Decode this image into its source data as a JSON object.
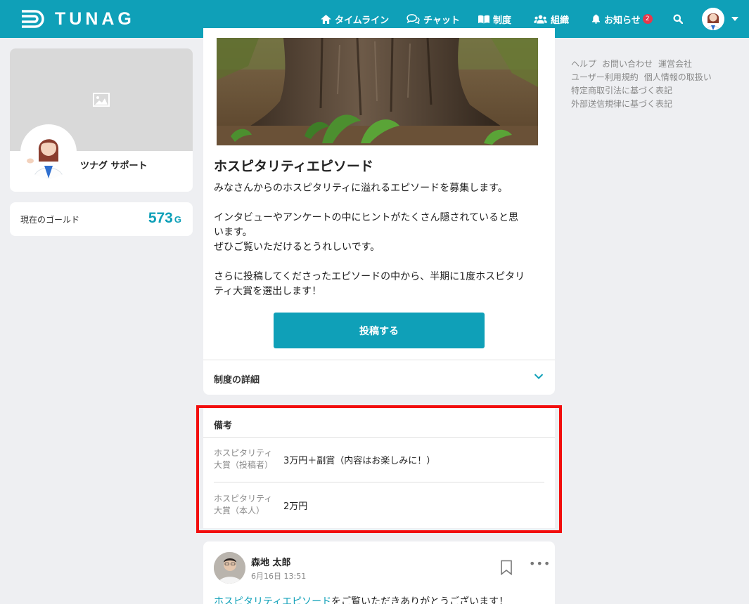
{
  "brand": {
    "name": "TUNAG"
  },
  "nav": {
    "timeline": "タイムライン",
    "chat": "チャット",
    "system": "制度",
    "org": "組織",
    "notifications": "お知らせ",
    "notification_count": "2"
  },
  "sidebar": {
    "profile_name": "ツナグ サポート",
    "gold_label": "現在のゴールド",
    "gold_value": "573",
    "gold_unit": "G"
  },
  "post": {
    "title": "ホスピタリティエピソード",
    "description": "みなさんからのホスピタリティに溢れるエピソードを募集します。\n\nインタビューやアンケートの中にヒントがたくさん隠されていると思\nいます。\nぜひご覧いただけるとうれしいです。\n\nさらに投稿してくださったエピソードの中から、半期に1度ホスピタリ\nティ大賞を選出します！",
    "post_button": "投稿する",
    "details_label": "制度の詳細"
  },
  "notes": {
    "title": "備考",
    "rows": [
      {
        "label": "ホスピタリティ\n大賞（投稿者）",
        "value": "3万円＋副賞（内容はお楽しみに！）"
      },
      {
        "label": "ホスピタリティ\n大賞（本人）",
        "value": "2万円"
      }
    ]
  },
  "comment": {
    "author": "森地 太郎",
    "date": "6月16日 13:51",
    "link_text": "ホスピタリティエピソード",
    "text": "をご覧いただきありがとうございます！"
  },
  "footer": {
    "links": [
      "ヘルプ",
      "お問い合わせ",
      "運営会社",
      "ユーザー利用規約",
      "個人情報の取扱い",
      "特定商取引法に基づく表記",
      "外部送信規律に基づく表記"
    ]
  },
  "colors": {
    "brand": "#0fa0b8",
    "highlight": "#f20d0d",
    "badge": "#e4384c"
  }
}
